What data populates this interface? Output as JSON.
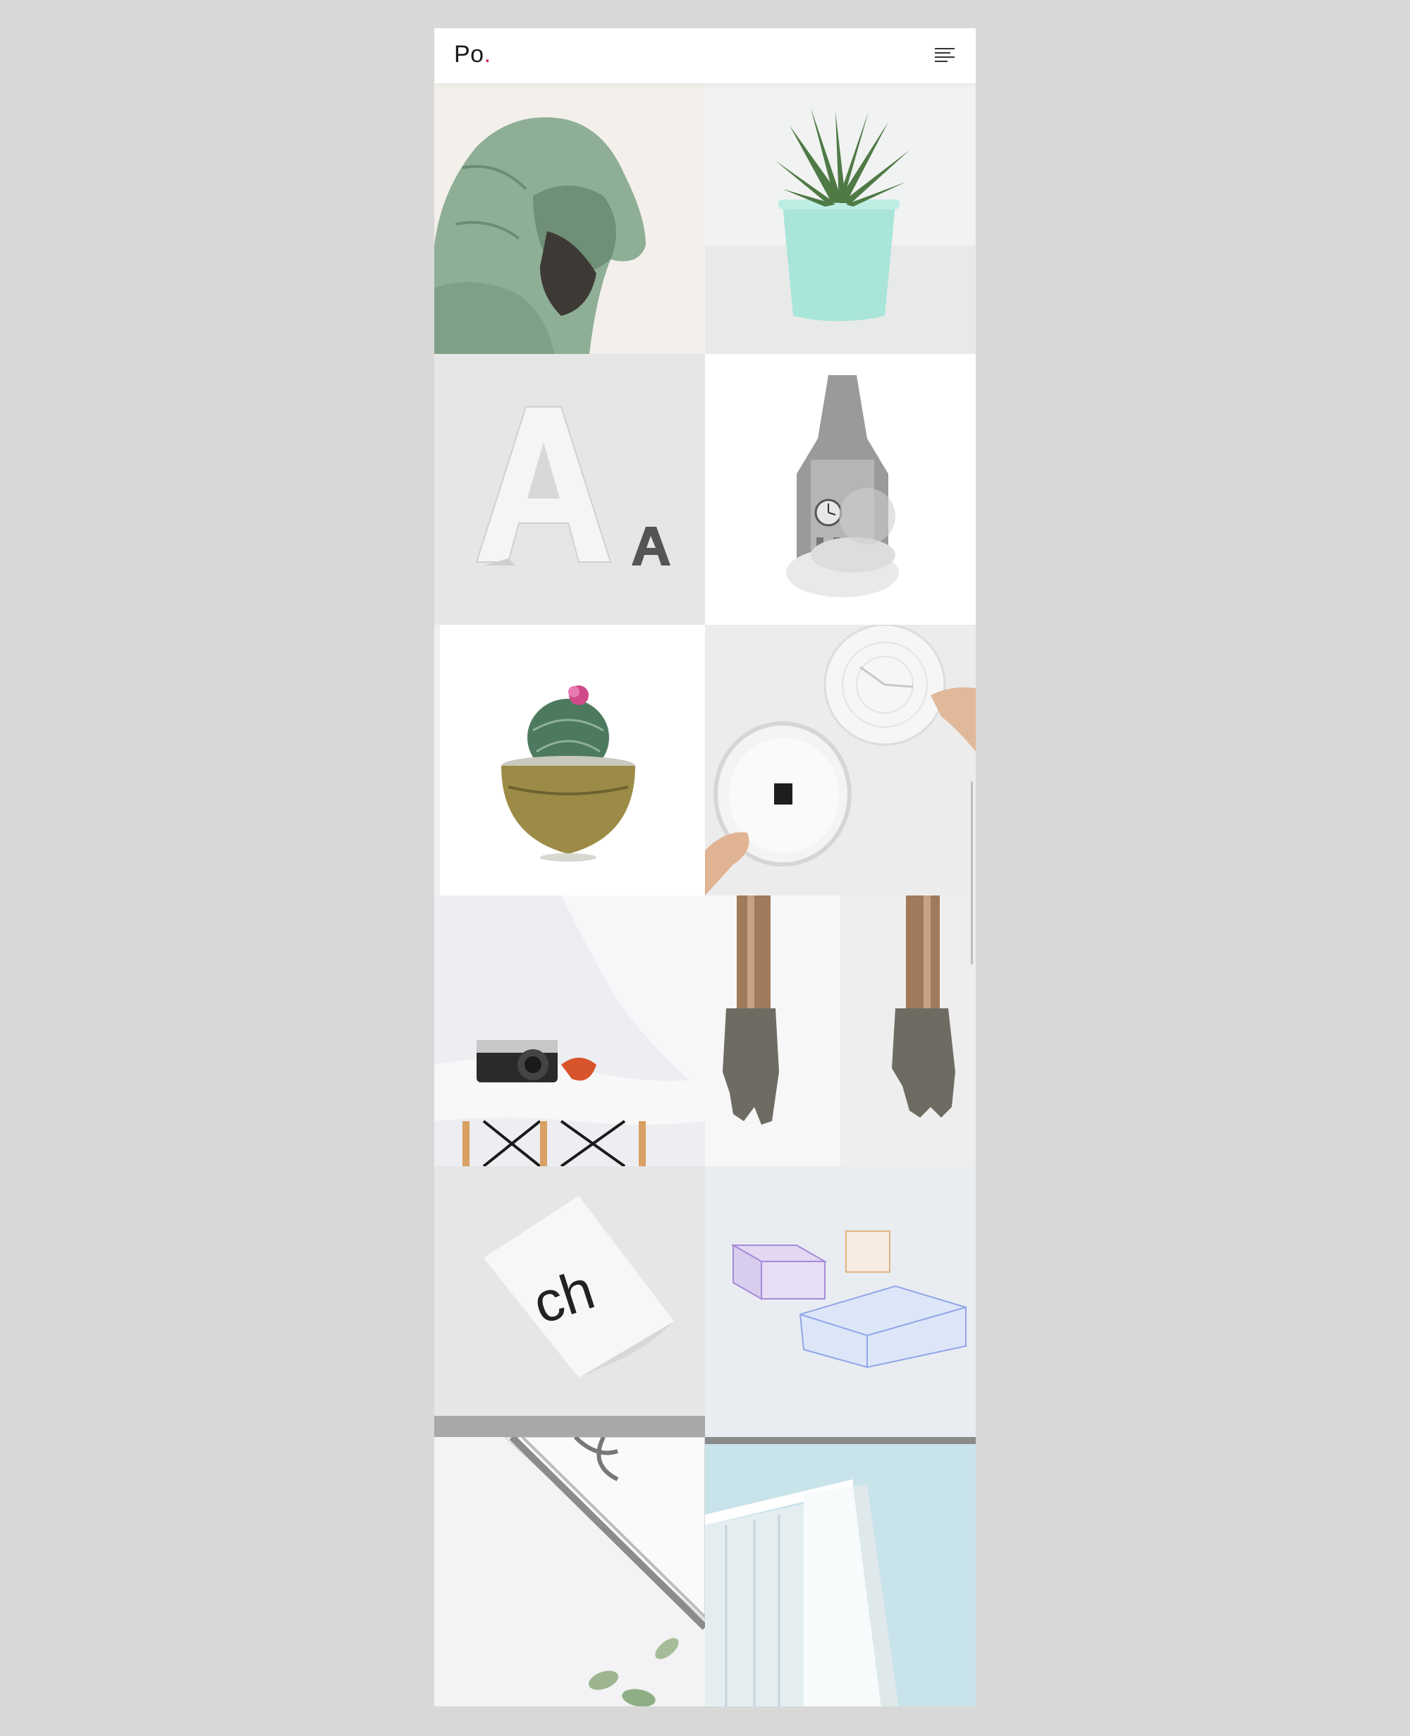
{
  "header": {
    "logo_text": "Po",
    "logo_dot": ".",
    "accent_color": "#d2204f",
    "menu_icon": "hamburger-menu-icon"
  },
  "gallery": {
    "items": [
      {
        "subject": "hooded-person-photo"
      },
      {
        "subject": "succulent-in-mint-pot-photo"
      },
      {
        "subject": "letter-a-sculptures-photo"
      },
      {
        "subject": "clock-tower-in-clouds-photo"
      },
      {
        "subject": "cactus-in-brass-bowl-photo"
      },
      {
        "subject": "hands-holding-wall-clock-photo"
      },
      {
        "subject": "camera-on-white-chair-photo"
      },
      {
        "subject": "bronze-hands-photo"
      },
      {
        "subject": "ch-typography-poster-photo"
      },
      {
        "subject": "glass-boxes-photo"
      },
      {
        "subject": "notebook-and-pencil-photo"
      },
      {
        "subject": "white-building-facade-photo"
      }
    ]
  }
}
